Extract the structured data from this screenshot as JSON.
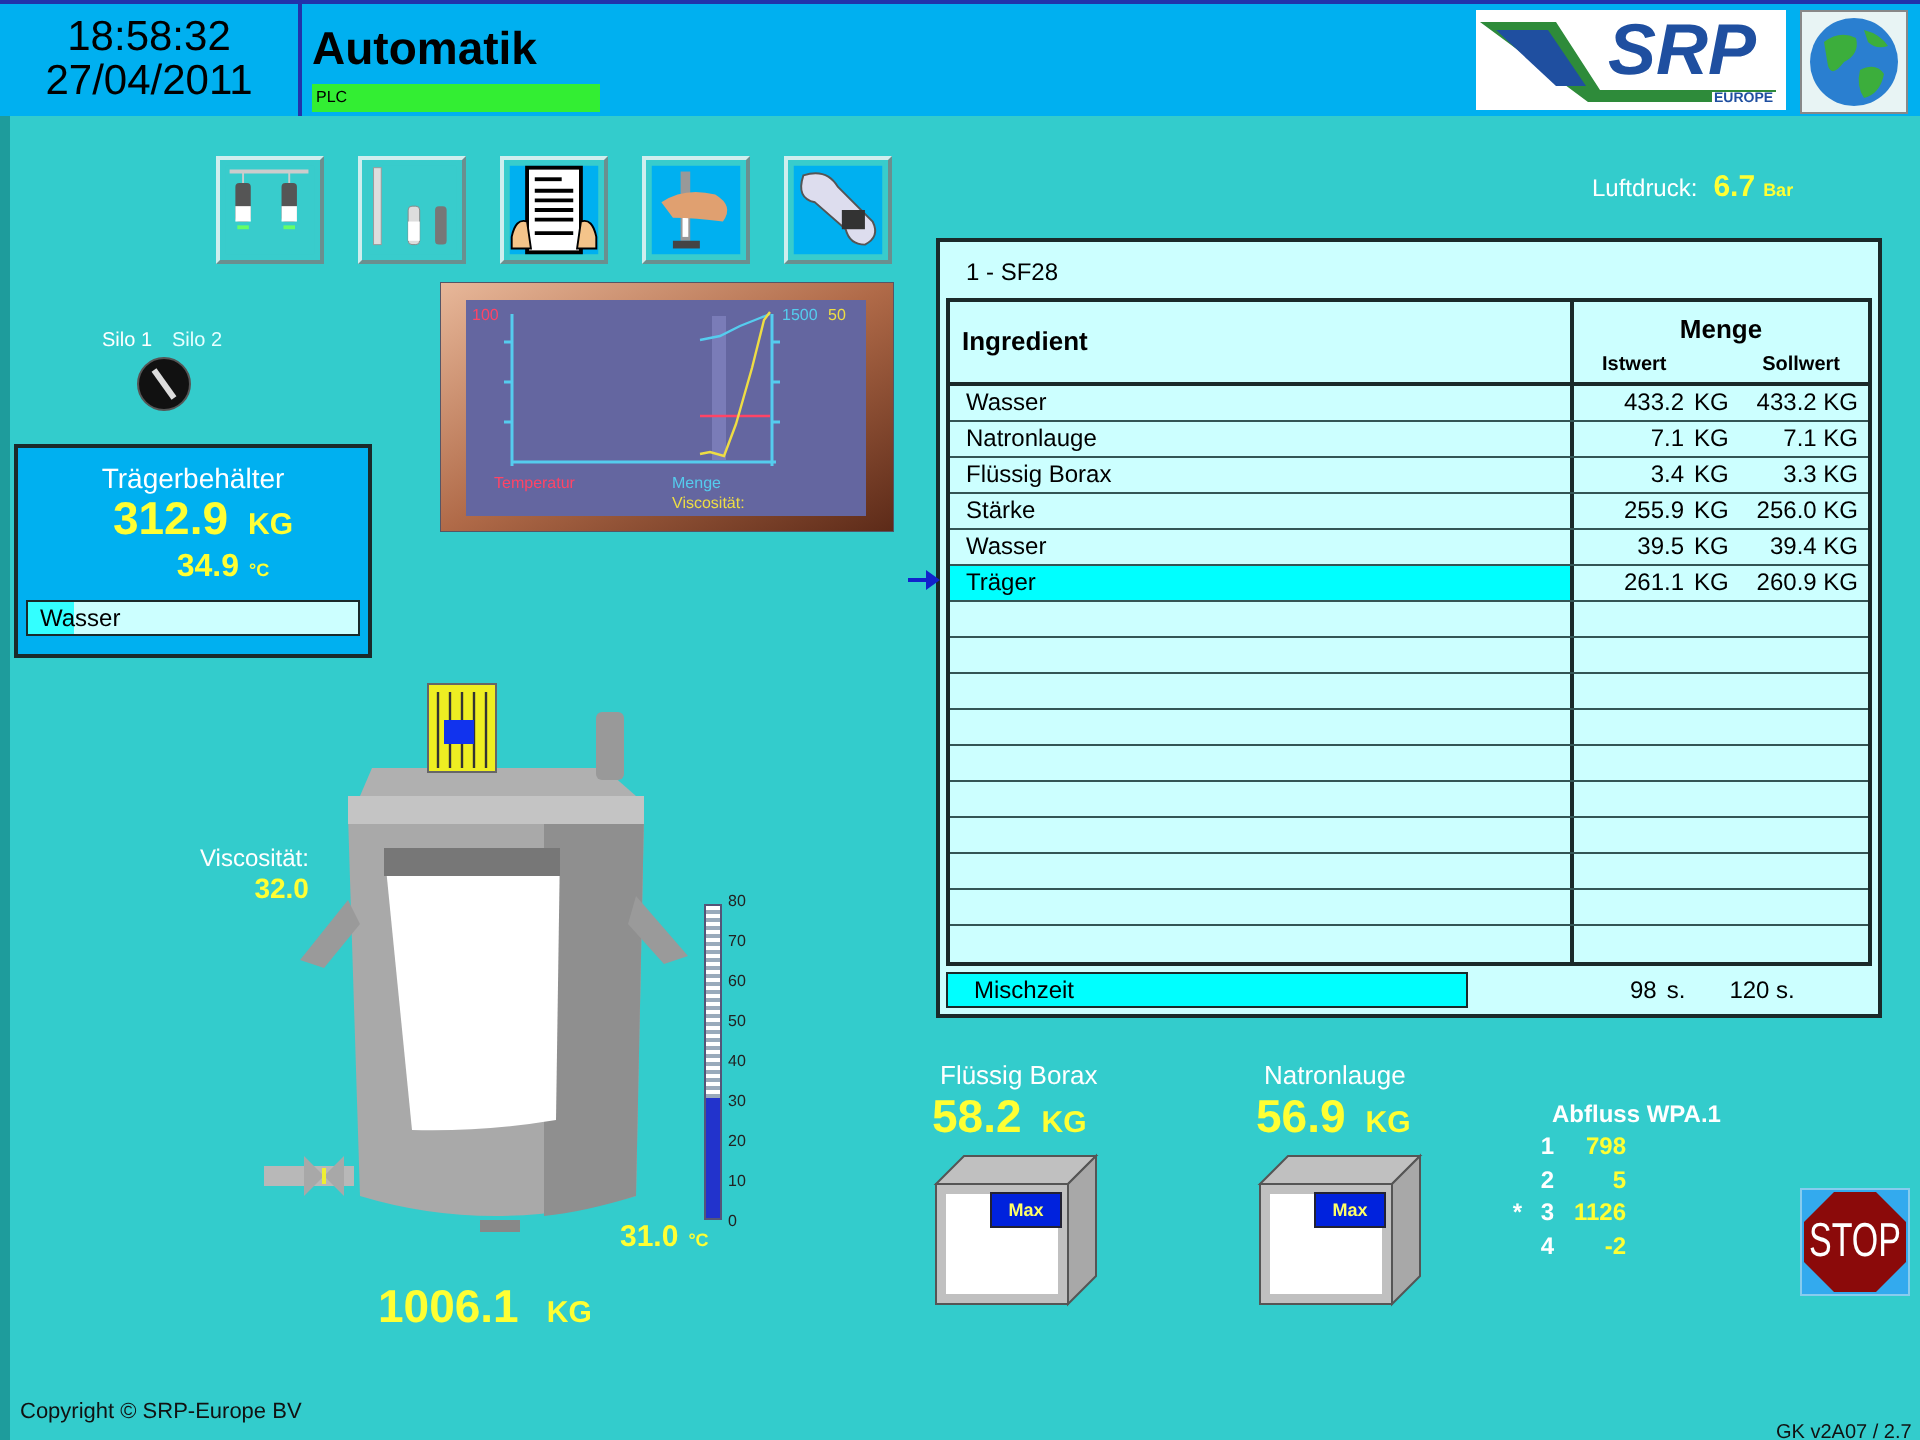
{
  "header": {
    "time": "18:58:32",
    "date": "27/04/2011",
    "title": "Automatik",
    "plc_label": "PLC",
    "logo": {
      "name": "SRP",
      "sub": "EUROPE"
    }
  },
  "toolbar": [
    {
      "kind": "tanks"
    },
    {
      "kind": "tube-tanks"
    },
    {
      "kind": "report"
    },
    {
      "kind": "sample"
    },
    {
      "kind": "tools"
    }
  ],
  "air_pressure": {
    "label": "Luftdruck:",
    "value": "6.7",
    "unit": "Bar"
  },
  "silo_selector": [
    {
      "label": "Silo 1",
      "selected": true
    },
    {
      "label": "Silo 2",
      "selected": false
    }
  ],
  "carrier_tank": {
    "title": "Trägerbehälter",
    "weight": "312.9",
    "weight_unit": "KG",
    "temperature": "34.9",
    "temperature_unit": "°C",
    "ingredient": {
      "label": "Wasser",
      "level": 0.14
    }
  },
  "trend": {
    "left_max": "100",
    "right_max": "1500",
    "right_max_2": "50",
    "legend": [
      {
        "label": "Temperatur",
        "color": "#ff4466"
      },
      {
        "label": "Menge",
        "color": "#55ccee"
      },
      {
        "label": "Viscosität:",
        "color": "#eedd44"
      }
    ]
  },
  "recipe": {
    "title": "1 - SF28",
    "columns": {
      "ingredient": "Ingredient",
      "amount": "Menge",
      "actual": "Istwert",
      "target": "Sollwert"
    },
    "rows": [
      {
        "name": "Wasser",
        "actual": "433.2",
        "unit": "KG",
        "target": "433.2 KG",
        "selected": false
      },
      {
        "name": "Natronlauge",
        "actual": "7.1",
        "unit": "KG",
        "target": "7.1 KG",
        "selected": false
      },
      {
        "name": "Flüssig Borax",
        "actual": "3.4",
        "unit": "KG",
        "target": "3.3 KG",
        "selected": false
      },
      {
        "name": "Stärke",
        "actual": "255.9",
        "unit": "KG",
        "target": "256.0 KG",
        "selected": false
      },
      {
        "name": "Wasser",
        "actual": "39.5",
        "unit": "KG",
        "target": "39.4 KG",
        "selected": false
      },
      {
        "name": "Träger",
        "actual": "261.1",
        "unit": "KG",
        "target": "260.9 KG",
        "selected": true
      }
    ],
    "mixing_time": {
      "label": "Mischzeit",
      "actual": "98",
      "unit": "s.",
      "target": "120 s."
    }
  },
  "mixer": {
    "viscosity_label": "Viscosität:",
    "viscosity": "32.0",
    "temperature": "31.0",
    "temperature_unit": "°C",
    "thermometer": {
      "level": 0.3875,
      "ticks": [
        "80",
        "70",
        "60",
        "50",
        "40",
        "30",
        "20",
        "10",
        "0"
      ]
    },
    "weight": "1006.1",
    "weight_unit": "KG"
  },
  "dosing": [
    {
      "name": "Flüssig Borax",
      "weight": "58.2",
      "unit": "KG",
      "max_label": "Max"
    },
    {
      "name": "Natronlauge",
      "weight": "56.9",
      "unit": "KG",
      "max_label": "Max"
    }
  ],
  "drain": {
    "title": "Abfluss WPA.1",
    "rows": [
      {
        "number": "1",
        "value": "798"
      },
      {
        "number": "2",
        "value": "5"
      },
      {
        "marker": "*",
        "number": "3",
        "value": "1126"
      },
      {
        "number": "4",
        "value": "-2"
      }
    ]
  },
  "stop_button": {
    "label": "STOP"
  },
  "footer": {
    "copyright": "Copyright ©  SRP-Europe BV",
    "version": "GK  v2A07 / 2.7"
  }
}
